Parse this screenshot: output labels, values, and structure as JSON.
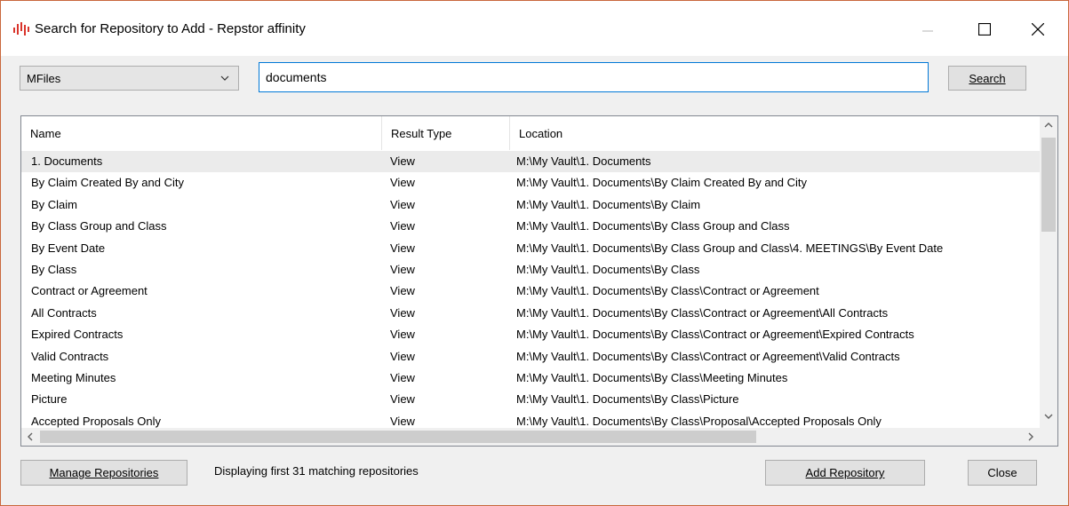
{
  "window": {
    "title": "Search for Repository to Add - Repstor affinity"
  },
  "repository_type": {
    "selected": "MFiles"
  },
  "search": {
    "value": "documents",
    "button_label": "Search"
  },
  "columns": [
    "Name",
    "Result Type",
    "Location"
  ],
  "rows": [
    {
      "name": "1. Documents",
      "type": "View",
      "location": "M:\\My Vault\\1. Documents"
    },
    {
      "name": "By Claim Created By and City",
      "type": "View",
      "location": "M:\\My Vault\\1. Documents\\By Claim Created By and City"
    },
    {
      "name": "By Claim",
      "type": "View",
      "location": "M:\\My Vault\\1. Documents\\By Claim"
    },
    {
      "name": "By Class Group and Class",
      "type": "View",
      "location": "M:\\My Vault\\1. Documents\\By Class Group and Class"
    },
    {
      "name": "By Event Date",
      "type": "View",
      "location": "M:\\My Vault\\1. Documents\\By Class Group and Class\\4. MEETINGS\\By Event Date"
    },
    {
      "name": "By Class",
      "type": "View",
      "location": "M:\\My Vault\\1. Documents\\By Class"
    },
    {
      "name": "Contract or Agreement",
      "type": "View",
      "location": "M:\\My Vault\\1. Documents\\By Class\\Contract or Agreement"
    },
    {
      "name": "All Contracts",
      "type": "View",
      "location": "M:\\My Vault\\1. Documents\\By Class\\Contract or Agreement\\All Contracts"
    },
    {
      "name": "Expired Contracts",
      "type": "View",
      "location": "M:\\My Vault\\1. Documents\\By Class\\Contract or Agreement\\Expired Contracts"
    },
    {
      "name": "Valid Contracts",
      "type": "View",
      "location": "M:\\My Vault\\1. Documents\\By Class\\Contract or Agreement\\Valid Contracts"
    },
    {
      "name": "Meeting Minutes",
      "type": "View",
      "location": "M:\\My Vault\\1. Documents\\By Class\\Meeting Minutes"
    },
    {
      "name": "Picture",
      "type": "View",
      "location": "M:\\My Vault\\1. Documents\\By Class\\Picture"
    },
    {
      "name": "Accepted Proposals Only",
      "type": "View",
      "location": "M:\\My Vault\\1. Documents\\By Class\\Proposal\\Accepted Proposals Only"
    }
  ],
  "footer": {
    "manage_label": "Manage Repositories",
    "status": "Displaying first 31 matching repositories",
    "add_label": "Add Repository",
    "close_label": "Close"
  },
  "colors": {
    "accent": "#0078d7",
    "window_border": "#c9673c",
    "app_icon": "#d9342b",
    "selected_row": "#ebebeb"
  }
}
